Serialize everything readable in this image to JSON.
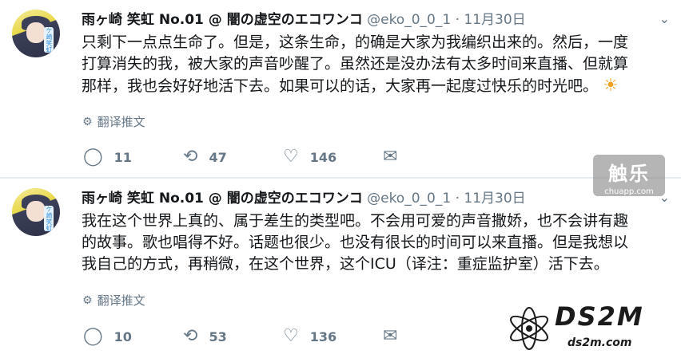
{
  "tweets": [
    {
      "user": {
        "name": "雨ヶ崎 笑虹 No.01 @ 闇の虚空のエコワンコ",
        "handle": "@eko_0_0_1",
        "separator": "·",
        "date": "11月30日"
      },
      "avatar_badge": "ケ崎笑虹",
      "text_lines": [
        "只剩下一点点生命了。但是，这条生命，的确是大家为我编织出来的。然后，一度",
        "打算消失的我，被大家的声音吵醒了。虽然还是没办法有太多时间来直播、但就算",
        "那样，我也会好好地活下去。如果可以的话，大家再一起度过快乐的时光吧。"
      ],
      "emoji": "☀",
      "translate_label": "翻译推文",
      "actions": {
        "reply": "11",
        "retweet": "47",
        "like": "146"
      }
    },
    {
      "user": {
        "name": "雨ヶ崎 笑虹 No.01 @ 闇の虚空のエコワンコ",
        "handle": "@eko_0_0_1",
        "separator": "·",
        "date": "11月30日"
      },
      "avatar_badge": "ケ崎笑虹",
      "text_lines": [
        "我在这个世界上真的、属于差生的类型吧。不会用可爱的声音撒娇，也不会讲有趣",
        "的故事。歌也唱得不好。话题也很少。也没有很长的时间可以来直播。但是我想以",
        "我自己的方式，再稍微，在这个世界，这个ICU（译注：重症监护室）活下去。"
      ],
      "emoji": "",
      "translate_label": "翻译推文",
      "actions": {
        "reply": "10",
        "retweet": "53",
        "like": "136"
      }
    }
  ],
  "icons": {
    "more": "chevron-down-icon",
    "reply": "reply-icon",
    "retweet": "retweet-icon",
    "like": "heart-icon",
    "dm": "mail-icon",
    "translate": "globe-icon"
  },
  "watermarks": {
    "chuapp_main": "触乐",
    "chuapp_sub": "chuapp.com",
    "ds_main": "DS2M",
    "ds_sub": "ds2m.com"
  },
  "colors": {
    "text": "#14171a",
    "muted": "#657786",
    "divider": "#e6ecf0",
    "sun": "#f0a020"
  }
}
